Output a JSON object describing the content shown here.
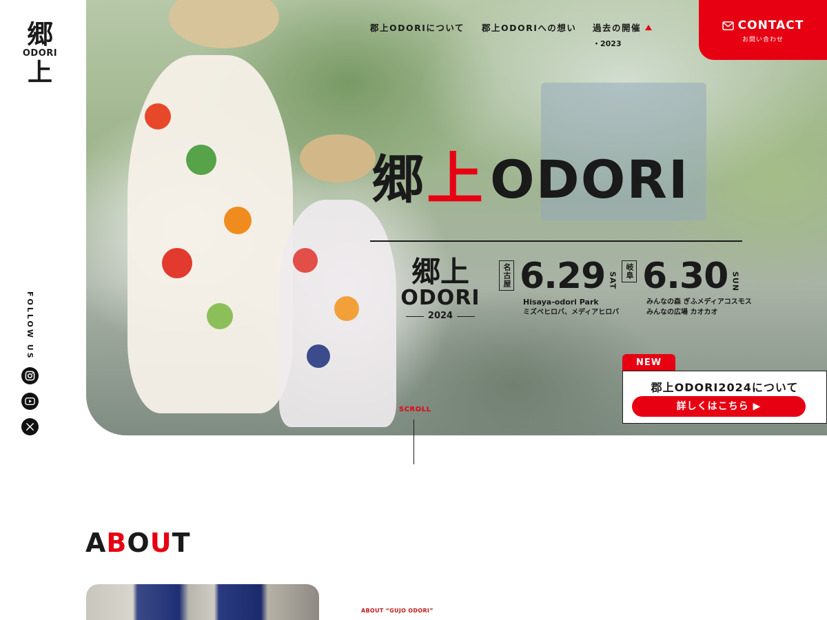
{
  "brand": {
    "logo_top": "郷",
    "logo_middle": "ODORI",
    "logo_bottom": "上",
    "accent_color": "#e60012"
  },
  "sidebar": {
    "follow_label": "FOLLOW US",
    "social": [
      "instagram-icon",
      "youtube-icon",
      "x-icon"
    ]
  },
  "nav": {
    "items": [
      {
        "label": "郡上ODORIについて"
      },
      {
        "label": "郡上ODORIへの想い"
      },
      {
        "label": "過去の開催"
      }
    ],
    "past_events": [
      "・2023"
    ],
    "contact": {
      "label": "CONTACT",
      "sub": "お問い合わせ",
      "icon": "mail-icon"
    }
  },
  "hero": {
    "logo_kanji_1": "郷",
    "logo_kanji_2": "上",
    "logo_text": "ODORI",
    "event_logo": {
      "line1": "郷上",
      "line2": "ODORI",
      "year": "2024"
    },
    "dates": [
      {
        "city": "名古屋",
        "date": "6.29",
        "day": "SAT",
        "venue_lines": [
          "Hisaya-odori Park",
          "ミズベヒロバ、メディアヒロバ"
        ]
      },
      {
        "city": "岐阜",
        "date": "6.30",
        "day": "SUN",
        "venue_lines": [
          "みんなの森 ぎふメディアコスモス",
          "みんなの広場 カオカオ"
        ]
      }
    ]
  },
  "news": {
    "badge": "NEW",
    "title": "郡上ODORI2024について",
    "button": "詳しくはこちら ▶"
  },
  "scroll": {
    "label": "SCROLL"
  },
  "about": {
    "heading": [
      "A",
      "B",
      "O",
      "U",
      "T"
    ],
    "sub_label": "ABOUT “GUJO ODORI”"
  }
}
